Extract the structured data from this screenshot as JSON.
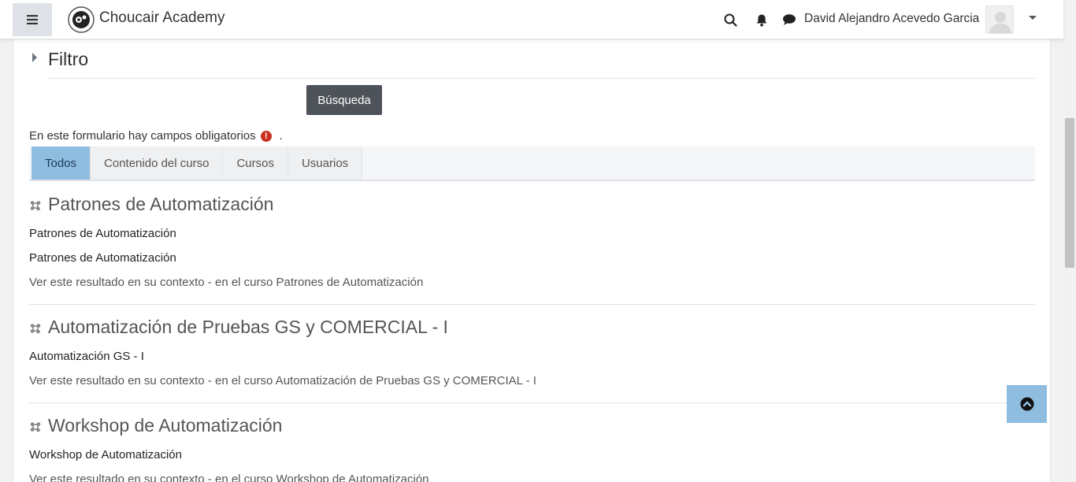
{
  "navbar": {
    "site_name": "Choucair Academy",
    "user_name": "David Alejandro Acevedo Garcia"
  },
  "filter": {
    "title": "Filtro",
    "search_button": "Búsqueda"
  },
  "required_note": {
    "text": "En este formulario hay campos obligatorios",
    "suffix": "."
  },
  "tabs": [
    {
      "label": "Todos",
      "active": true
    },
    {
      "label": "Contenido del curso",
      "active": false
    },
    {
      "label": "Cursos",
      "active": false
    },
    {
      "label": "Usuarios",
      "active": false
    }
  ],
  "results": [
    {
      "title": "Patrones de Automatización",
      "lines": [
        "Patrones de Automatización",
        "Patrones de Automatización"
      ],
      "context": "Ver este resultado en su contexto - en el curso Patrones de Automatización"
    },
    {
      "title": "Automatización de Pruebas GS y COMERCIAL - I",
      "lines": [
        "Automatización GS - I"
      ],
      "context": "Ver este resultado en su contexto - en el curso Automatización de Pruebas GS y COMERCIAL - I"
    },
    {
      "title": "Workshop de Automatización",
      "lines": [
        "Workshop de Automatización"
      ],
      "context": "Ver este resultado en su contexto - en el curso Workshop de Automatización"
    }
  ],
  "colors": {
    "active_tab": "#8fbde0",
    "search_button": "#4e5259",
    "required_icon": "#ca3120"
  }
}
